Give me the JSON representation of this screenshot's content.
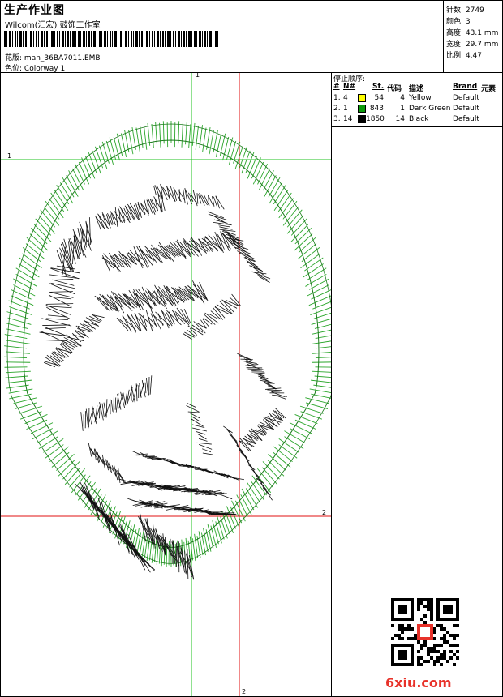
{
  "header": {
    "title": "生产作业图",
    "studio": "Wilcom(汇宏) 鼓饰工作室",
    "design_label": "花版:",
    "design_file": "man_36BA7011.EMB",
    "colorway_label": "色位:",
    "colorway": "Colorway 1"
  },
  "stats": [
    {
      "label": "针数:",
      "value": "2749"
    },
    {
      "label": "颜色:",
      "value": "3"
    },
    {
      "label": "高度:",
      "value": "43.1 mm"
    },
    {
      "label": "宽度:",
      "value": "29.7 mm"
    },
    {
      "label": "比例:",
      "value": "4.47"
    }
  ],
  "stop_sequence": {
    "heading": "停止顺序:",
    "columns": {
      "num": "#",
      "n": "N#",
      "st": "St.",
      "code": "代码",
      "desc": "描述",
      "brand": "Brand",
      "element": "元素"
    },
    "rows": [
      {
        "index": "1.",
        "n": "4",
        "color": "#ffff00",
        "st": "54",
        "code": "4",
        "desc": "Yellow",
        "brand": "Default"
      },
      {
        "index": "2.",
        "n": "1",
        "color": "#0a9a0a",
        "st": "843",
        "code": "1",
        "desc": "Dark Green",
        "brand": "Default"
      },
      {
        "index": "3.",
        "n": "14",
        "color": "#000000",
        "st": "1850",
        "code": "14",
        "desc": "Black",
        "brand": "Default"
      }
    ]
  },
  "guides": {
    "v1": "1",
    "h1": "1",
    "h2": "2",
    "v2": "2"
  },
  "watermark": "6xiu.com",
  "colors": {
    "guide_green": "#22c322",
    "guide_red": "#e01010",
    "stitch_green": "#2aa52a"
  }
}
